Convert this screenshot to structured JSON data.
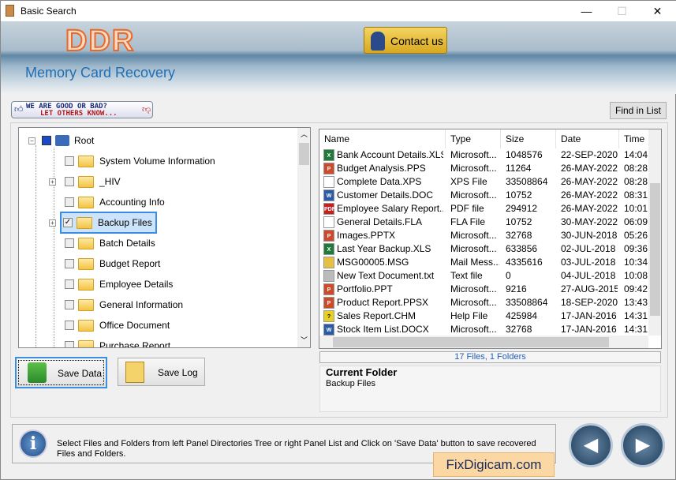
{
  "window": {
    "title": "Basic Search",
    "minimize": "—",
    "maximize": "☐",
    "close": "✕"
  },
  "banner": {
    "logo": "DDR",
    "product": "Memory Card Recovery",
    "contact_label": "Contact us"
  },
  "feedback": {
    "line1": "WE ARE GOOD OR BAD?",
    "line2": "LET OTHERS KNOW..."
  },
  "find_label": "Find in List",
  "tree": {
    "root": "Root",
    "items": [
      {
        "label": "System Volume Information",
        "expandable": false,
        "checked": false
      },
      {
        "label": "_HIV",
        "expandable": true,
        "checked": false
      },
      {
        "label": "Accounting Info",
        "expandable": false,
        "checked": false
      },
      {
        "label": "Backup Files",
        "expandable": true,
        "checked": true,
        "selected": true
      },
      {
        "label": "Batch Details",
        "expandable": false,
        "checked": false
      },
      {
        "label": "Budget Report",
        "expandable": false,
        "checked": false
      },
      {
        "label": "Employee Details",
        "expandable": false,
        "checked": false
      },
      {
        "label": "General Information",
        "expandable": false,
        "checked": false
      },
      {
        "label": "Office Document",
        "expandable": false,
        "checked": false
      },
      {
        "label": "Purchase Report",
        "expandable": false,
        "checked": false
      }
    ]
  },
  "list": {
    "columns": [
      "Name",
      "Type",
      "Size",
      "Date",
      "Time"
    ],
    "rows": [
      {
        "icon": "excel",
        "name": "Bank Account Details.XLSX",
        "type": "Microsoft...",
        "size": "1048576",
        "date": "22-SEP-2020",
        "time": "14:04"
      },
      {
        "icon": "powerpoint",
        "name": "Budget Analysis.PPS",
        "type": "Microsoft...",
        "size": "11264",
        "date": "26-MAY-2022",
        "time": "08:28"
      },
      {
        "icon": "blank",
        "name": "Complete Data.XPS",
        "type": "XPS File",
        "size": "33508864",
        "date": "26-MAY-2022",
        "time": "08:28"
      },
      {
        "icon": "word",
        "name": "Customer Details.DOC",
        "type": "Microsoft...",
        "size": "10752",
        "date": "26-MAY-2022",
        "time": "08:31"
      },
      {
        "icon": "pdf",
        "name": "Employee Salary Report....",
        "type": "PDF file",
        "size": "294912",
        "date": "26-MAY-2022",
        "time": "10:01"
      },
      {
        "icon": "blank",
        "name": "General Details.FLA",
        "type": "FLA File",
        "size": "10752",
        "date": "30-MAY-2022",
        "time": "06:09"
      },
      {
        "icon": "powerpoint",
        "name": "Images.PPTX",
        "type": "Microsoft...",
        "size": "32768",
        "date": "30-JUN-2018",
        "time": "05:26"
      },
      {
        "icon": "excel",
        "name": "Last Year Backup.XLS",
        "type": "Microsoft...",
        "size": "633856",
        "date": "02-JUL-2018",
        "time": "09:36"
      },
      {
        "icon": "mail",
        "name": "MSG00005.MSG",
        "type": "Mail Mess...",
        "size": "4335616",
        "date": "03-JUL-2018",
        "time": "10:34"
      },
      {
        "icon": "text",
        "name": "New Text Document.txt",
        "type": "Text file",
        "size": "0",
        "date": "04-JUL-2018",
        "time": "10:08"
      },
      {
        "icon": "powerpoint",
        "name": "Portfolio.PPT",
        "type": "Microsoft...",
        "size": "9216",
        "date": "27-AUG-2015",
        "time": "09:42"
      },
      {
        "icon": "powerpoint",
        "name": "Product Report.PPSX",
        "type": "Microsoft...",
        "size": "33508864",
        "date": "18-SEP-2020",
        "time": "13:43"
      },
      {
        "icon": "help",
        "name": "Sales Report.CHM",
        "type": "Help File",
        "size": "425984",
        "date": "17-JAN-2016",
        "time": "14:31"
      },
      {
        "icon": "word",
        "name": "Stock Item List.DOCX",
        "type": "Microsoft...",
        "size": "32768",
        "date": "17-JAN-2016",
        "time": "14:31"
      }
    ]
  },
  "status": "17 Files, 1 Folders",
  "current_folder": {
    "title": "Current Folder",
    "value": "Backup Files"
  },
  "buttons": {
    "save_data": "Save Data",
    "save_log": "Save Log"
  },
  "info": "Select Files and Folders from left Panel Directories Tree or right Panel List and Click on 'Save Data' button to save recovered Files and Folders.",
  "nav": {
    "back": "◀",
    "forward": "▶"
  },
  "brand": "FixDigicam.com",
  "icon_colors": {
    "excel": "#1e7b3a",
    "powerpoint": "#d04a2a",
    "word": "#2a5aa8",
    "pdf": "#c81e1e",
    "mail": "#e8c040",
    "text": "#bbbbbb",
    "help": "#e8d020",
    "blank": "#ffffff"
  }
}
